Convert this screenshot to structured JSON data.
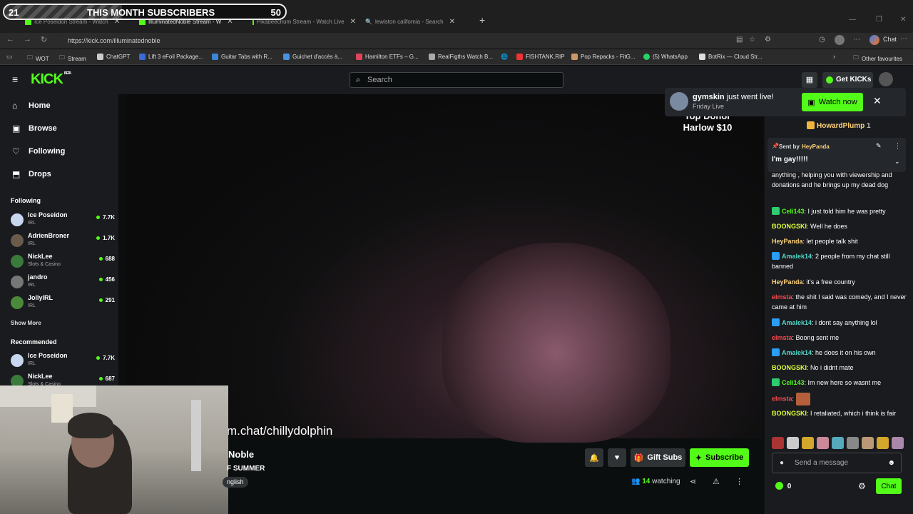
{
  "overlay": {
    "subs_current": "21",
    "subs_label": "THIS MONTH SUBSCRIBERS",
    "subs_goal": "50",
    "progress": 0.42
  },
  "browser": {
    "tabs": [
      {
        "label": "Ice Poseidon Stream - Watch",
        "active": false
      },
      {
        "label": "IlluminatedNoble Stream - W",
        "active": true
      },
      {
        "label": "Pikabeechum Stream - Watch Live",
        "active": false
      },
      {
        "label": "lewiston california - Search",
        "active": false
      }
    ],
    "url": "https://kick.com/illuminatednoble",
    "profile_label": "Chat",
    "bookmarks": [
      "WOT",
      "Stream",
      "ChatGPT",
      "Lift 3 eFoil Package...",
      "Guitar Tabs with R...",
      "Guichet d'accès à...",
      "Hamilton ETFs – G...",
      "RealFigths Watch B...",
      "FISHTANK.RIP",
      "Pop Repacks - FitG...",
      "(5) WhatsApp",
      "BotRix — Cloud Str..."
    ],
    "other_favourites": "Other favourites"
  },
  "kick": {
    "logo": "KICK",
    "logo_tag": "BETA",
    "search_placeholder": "Search",
    "get_kicks": "Get KICKs"
  },
  "sidebar": {
    "nav": [
      {
        "label": "Home",
        "icon": "home-icon"
      },
      {
        "label": "Browse",
        "icon": "browse-icon"
      },
      {
        "label": "Following",
        "icon": "heart-icon"
      },
      {
        "label": "Drops",
        "icon": "drops-icon"
      }
    ],
    "following_heading": "Following",
    "following": [
      {
        "name": "Ice Poseidon",
        "category": "IRL",
        "viewers": "7.7K"
      },
      {
        "name": "AdrienBroner",
        "category": "IRL",
        "viewers": "1.7K"
      },
      {
        "name": "NickLee",
        "category": "Slots & Casino",
        "viewers": "688"
      },
      {
        "name": "jandro",
        "category": "IRL",
        "viewers": "456"
      },
      {
        "name": "JollyIRL",
        "category": "IRL",
        "viewers": "291"
      }
    ],
    "show_more": "Show More",
    "recommended_heading": "Recommended",
    "recommended": [
      {
        "name": "Ice Poseidon",
        "category": "IRL",
        "viewers": "7.7K"
      },
      {
        "name": "NickLee",
        "category": "Slots & Casino",
        "viewers": "687"
      }
    ]
  },
  "video": {
    "top_donor": "Top Donor",
    "top_donor_value": "Harlow $10",
    "chat_url": "m.chat/chillydolphin"
  },
  "stream": {
    "title": "Noble",
    "subtitle": "F SUMMER",
    "language": "nglish",
    "gift_subs": "Gift Subs",
    "subscribe": "Subscribe",
    "watching_count": "14",
    "watching_label": "watching"
  },
  "toast": {
    "user": "gymskin",
    "text": "just went live!",
    "sub": "Friday Live",
    "button": "Watch now"
  },
  "chat": {
    "top_user": "HowardPlump",
    "top_count": "1",
    "pinned_by_label": "Sent by",
    "pinned_by": "HeyPanda",
    "pinned_text": "I'm gay!!!!!",
    "messages": [
      {
        "user": "",
        "text": "anything , helping you with viewership and donations and he brings up my dead dog",
        "color": "#ffffff",
        "badge": ""
      },
      {
        "user": "Celi143",
        "text": "I just told him he was pretty",
        "color": "#53fc18",
        "badge": "#2ecc71"
      },
      {
        "user": "BOONGSKI",
        "text": "Well he does",
        "color": "#dfff3a",
        "badge": ""
      },
      {
        "user": "HeyPanda",
        "text": "let people talk shit",
        "color": "#ffd37a",
        "badge": ""
      },
      {
        "user": "Amalek14",
        "text": "2 people from my chat still banned",
        "color": "#4fd6c7",
        "badge": "#2a9df4"
      },
      {
        "user": "HeyPanda",
        "text": "it's a free country",
        "color": "#ffd37a",
        "badge": ""
      },
      {
        "user": "elmsta",
        "text": "the shit I said was comedy, and I never came at him",
        "color": "#ff4b4b",
        "badge": ""
      },
      {
        "user": "Amalek14",
        "text": "i dont say anything lol",
        "color": "#4fd6c7",
        "badge": "#2a9df4"
      },
      {
        "user": "elmsta",
        "text": "Boong sent me",
        "color": "#ff4b4b",
        "badge": ""
      },
      {
        "user": "Amalek14",
        "text": "he does it on his own",
        "color": "#4fd6c7",
        "badge": "#2a9df4"
      },
      {
        "user": "BOONGSKI",
        "text": "No i didnt mate",
        "color": "#dfff3a",
        "badge": ""
      },
      {
        "user": "Celi143",
        "text": "Im new here so wasnt me",
        "color": "#53fc18",
        "badge": "#2ecc71"
      },
      {
        "user": "elmsta",
        "text": "",
        "color": "#ff4b4b",
        "badge": ""
      },
      {
        "user": "BOONGSKI",
        "text": "I retaliated, which i think is fair",
        "color": "#dfff3a",
        "badge": ""
      }
    ],
    "input_placeholder": "Send a message",
    "kicks_count": "0",
    "chat_button": "Chat"
  }
}
